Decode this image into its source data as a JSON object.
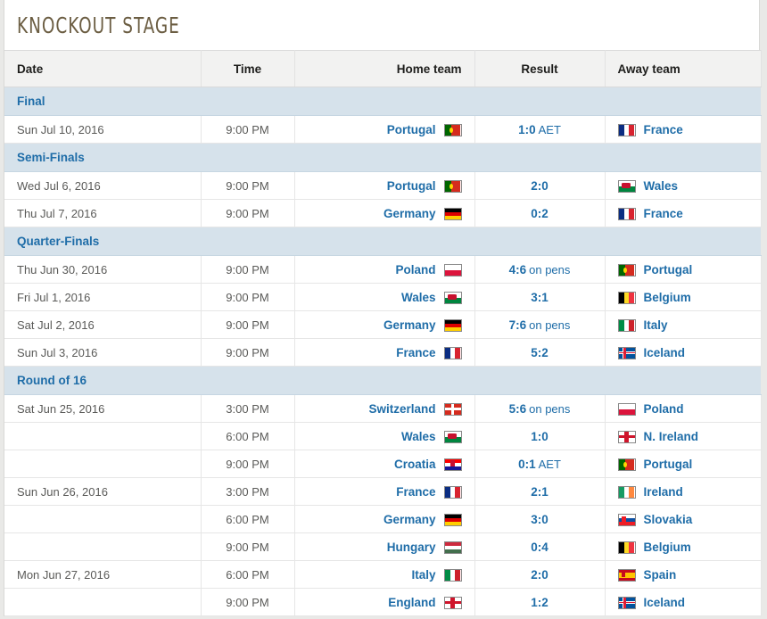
{
  "page": {
    "title": "KNOCKOUT STAGE"
  },
  "table": {
    "headers": {
      "date": "Date",
      "time": "Time",
      "home": "Home team",
      "result": "Result",
      "away": "Away team"
    },
    "sections": [
      {
        "name": "Final",
        "matches": [
          {
            "date": "Sun Jul 10, 2016",
            "time": "9:00 PM",
            "home_team": "Portugal",
            "home_flag": "portugal",
            "score": "1:0",
            "note": "AET",
            "away_team": "France",
            "away_flag": "france",
            "winner": "home"
          }
        ]
      },
      {
        "name": "Semi-Finals",
        "matches": [
          {
            "date": "Wed Jul 6, 2016",
            "time": "9:00 PM",
            "home_team": "Portugal",
            "home_flag": "portugal",
            "score": "2:0",
            "note": "",
            "away_team": "Wales",
            "away_flag": "wales",
            "winner": "home"
          },
          {
            "date": "Thu Jul 7, 2016",
            "time": "9:00 PM",
            "home_team": "Germany",
            "home_flag": "germany",
            "score": "0:2",
            "note": "",
            "away_team": "France",
            "away_flag": "france",
            "winner": "away"
          }
        ]
      },
      {
        "name": "Quarter-Finals",
        "matches": [
          {
            "date": "Thu Jun 30, 2016",
            "time": "9:00 PM",
            "home_team": "Poland",
            "home_flag": "poland",
            "score": "4:6",
            "note": "on pens",
            "away_team": "Portugal",
            "away_flag": "portugal",
            "winner": "away"
          },
          {
            "date": "Fri Jul 1, 2016",
            "time": "9:00 PM",
            "home_team": "Wales",
            "home_flag": "wales",
            "score": "3:1",
            "note": "",
            "away_team": "Belgium",
            "away_flag": "belgium",
            "winner": "home"
          },
          {
            "date": "Sat Jul 2, 2016",
            "time": "9:00 PM",
            "home_team": "Germany",
            "home_flag": "germany",
            "score": "7:6",
            "note": "on pens",
            "away_team": "Italy",
            "away_flag": "italy",
            "winner": "home"
          },
          {
            "date": "Sun Jul 3, 2016",
            "time": "9:00 PM",
            "home_team": "France",
            "home_flag": "france",
            "score": "5:2",
            "note": "",
            "away_team": "Iceland",
            "away_flag": "iceland",
            "winner": "home"
          }
        ]
      },
      {
        "name": "Round of 16",
        "matches": [
          {
            "date": "Sat Jun 25, 2016",
            "time": "3:00 PM",
            "home_team": "Switzerland",
            "home_flag": "switzerland",
            "score": "5:6",
            "note": "on pens",
            "away_team": "Poland",
            "away_flag": "poland",
            "winner": "away"
          },
          {
            "date": "",
            "time": "6:00 PM",
            "home_team": "Wales",
            "home_flag": "wales",
            "score": "1:0",
            "note": "",
            "away_team": "N. Ireland",
            "away_flag": "nireland",
            "winner": "home"
          },
          {
            "date": "",
            "time": "9:00 PM",
            "home_team": "Croatia",
            "home_flag": "croatia",
            "score": "0:1",
            "note": "AET",
            "away_team": "Portugal",
            "away_flag": "portugal",
            "winner": "away"
          },
          {
            "date": "Sun Jun 26, 2016",
            "time": "3:00 PM",
            "home_team": "France",
            "home_flag": "france",
            "score": "2:1",
            "note": "",
            "away_team": "Ireland",
            "away_flag": "ireland",
            "winner": "home"
          },
          {
            "date": "",
            "time": "6:00 PM",
            "home_team": "Germany",
            "home_flag": "germany",
            "score": "3:0",
            "note": "",
            "away_team": "Slovakia",
            "away_flag": "slovakia",
            "winner": "home"
          },
          {
            "date": "",
            "time": "9:00 PM",
            "home_team": "Hungary",
            "home_flag": "hungary",
            "score": "0:4",
            "note": "",
            "away_team": "Belgium",
            "away_flag": "belgium",
            "winner": "away"
          },
          {
            "date": "Mon Jun 27, 2016",
            "time": "6:00 PM",
            "home_team": "Italy",
            "home_flag": "italy",
            "score": "2:0",
            "note": "",
            "away_team": "Spain",
            "away_flag": "spain",
            "winner": "home"
          },
          {
            "date": "",
            "time": "9:00 PM",
            "home_team": "England",
            "home_flag": "england",
            "score": "1:2",
            "note": "",
            "away_team": "Iceland",
            "away_flag": "iceland",
            "winner": "away"
          }
        ]
      }
    ]
  },
  "colors": {
    "accent_link": "#1f6da8",
    "section_bg": "#d6e2eb",
    "winner_bg": "#fdf2d8",
    "title_text": "#6b5d42"
  }
}
